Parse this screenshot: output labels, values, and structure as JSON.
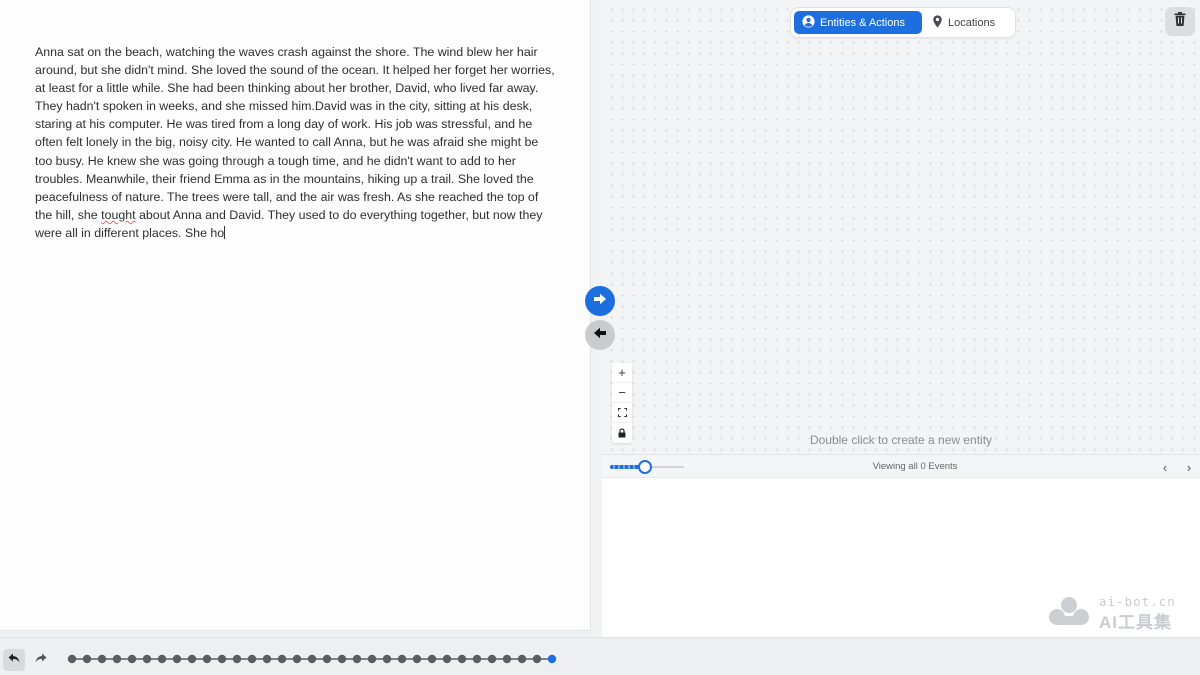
{
  "editor": {
    "paragraph_before_misspelling": "Anna sat on the beach, watching the waves crash against the shore. The wind blew her hair around, but she didn't mind. She loved the sound of the ocean. It helped her forget her worries, at least for a little while. She had been thinking about her brother, David, who lived far away. They hadn't spoken in weeks, and she missed him.David was in the city, sitting at his desk, staring at his computer. He was tired from a long day of work. His job was stressful, and he often felt lonely in the big, noisy city. He wanted to call Anna, but he was afraid she might be too busy. He knew she was going through a tough time, and he didn't want to add to her troubles. Meanwhile, their friend Emma as in the mountains, hiking up a trail. She loved the peacefulness of nature. The trees were tall, and the air was fresh. As she reached the top of the hill, she ",
    "misspelled_word": "tought",
    "paragraph_after_misspelling": " about Anna and David. They used to do everything together, but now they were all in different places. She ho"
  },
  "view_toggle": {
    "entities_label": "Entities & Actions",
    "locations_label": "Locations",
    "active": "entities"
  },
  "canvas": {
    "hint": "Double click to create a new entity",
    "zoom_in": "+",
    "zoom_out": "−"
  },
  "timeline": {
    "status": "Viewing all 0 Events",
    "prev": "‹",
    "next": "›",
    "slider_fraction": 0.45
  },
  "history": {
    "steps": 33,
    "current_step": 33
  },
  "watermark": {
    "line1": "ai-bot.cn",
    "line2": "AI工具集"
  },
  "colors": {
    "accent": "#1d6fe0",
    "canvas_bg": "#f3f4f6",
    "history_dot": "#5a5d62"
  },
  "icons": {
    "entities": "user-circle-icon",
    "locations": "map-pin-icon",
    "trash": "trash-icon",
    "send_right": "arrow-right-icon",
    "send_left": "arrow-left-icon",
    "fit": "fit-view-icon",
    "lock": "lock-icon",
    "undo": "undo-icon",
    "redo": "redo-icon"
  }
}
